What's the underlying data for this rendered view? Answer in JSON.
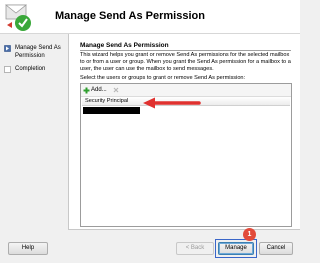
{
  "header": {
    "title": "Manage Send As Permission",
    "icon": "wizard-check-icon"
  },
  "nav": {
    "items": [
      {
        "label": "Manage Send As Permission",
        "icon": "step-current-icon",
        "active": true
      },
      {
        "label": "Completion",
        "icon": "step-pending-icon",
        "active": false
      }
    ]
  },
  "main": {
    "section_heading": "Manage Send As Permission",
    "description": "This wizard helps you grant or remove Send As permissions for the selected mailbox to or from a user or group. When you grant the Send As permission for a mailbox to a user, the user can use the mailbox to send messages.",
    "select_label": "Select the users or groups to grant or remove Send As permission:",
    "toolbar": {
      "add_label": "Add...",
      "add_icon": "add-icon",
      "remove_icon": "remove-icon"
    },
    "table": {
      "column_header": "Security Principal"
    }
  },
  "footer": {
    "help_label": "Help",
    "back_label": "< Back",
    "manage_label": "Manage",
    "cancel_label": "Cancel"
  },
  "annotation": {
    "step_number": "1",
    "arrow_color": "#e0312f",
    "badge_color": "#e24b3b",
    "highlight_color": "#3a66c9"
  }
}
